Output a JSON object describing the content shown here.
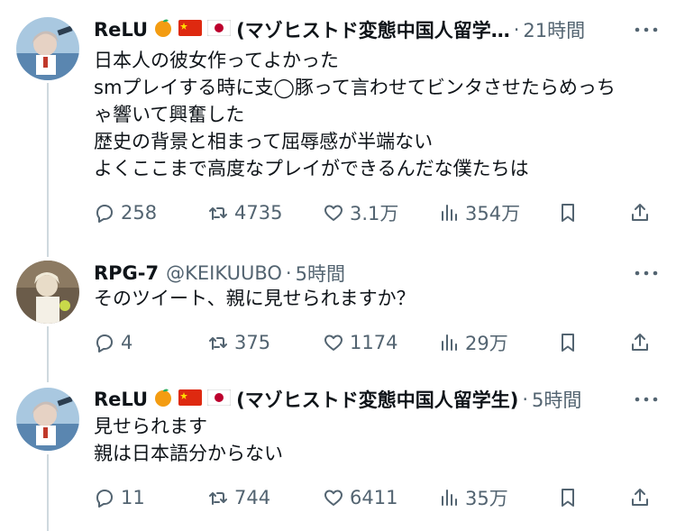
{
  "tweets": [
    {
      "name": "ReLU",
      "display_suffix": "(マゾヒストド変態中国人留学…",
      "time": "21時間",
      "body": "日本人の彼女作ってよかった\nsmプレイする時に支◯豚って言わせてビンタさせたらめっち\nゃ響いて興奮した\n歴史の背景と相まって屈辱感が半端ない\nよくここまで高度なプレイができるんだな僕たちは",
      "replies": "258",
      "retweets": "4735",
      "likes": "3.1万",
      "views": "354万"
    },
    {
      "name": "RPG-7",
      "handle": "@KEIKUUBO",
      "time": "5時間",
      "body": "そのツイート、親に見せられますか？",
      "replies": "4",
      "retweets": "375",
      "likes": "1174",
      "views": "29万"
    },
    {
      "name": "ReLU",
      "display_suffix": "(マゾヒストド変態中国人留学生)",
      "time": "5時間",
      "body": "見せられます\n親は日本語分からない",
      "replies": "11",
      "retweets": "744",
      "likes": "6411",
      "views": "35万"
    }
  ],
  "icons": [
    "reply-icon",
    "retweet-icon",
    "like-icon",
    "views-icon",
    "bookmark-icon",
    "share-icon",
    "more-icon"
  ],
  "colors": {
    "text": "#0f1419",
    "secondary": "#536471",
    "thread_line": "#cfd9de",
    "background": "#ffffff"
  }
}
